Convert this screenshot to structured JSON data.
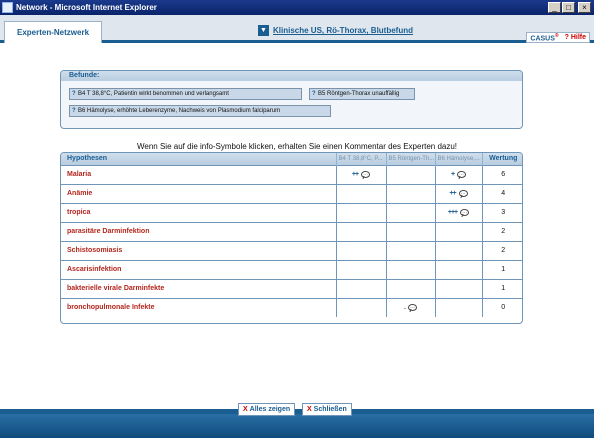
{
  "window": {
    "title": "Network - Microsoft Internet Explorer",
    "buttons": {
      "minimize": "_",
      "maximize": "□",
      "close": "×"
    }
  },
  "header": {
    "active_tab": "Experten-Netzwerk",
    "dropdown_label": "Klinische US, Rö-Thorax, Blutbefund",
    "casus_logo": "CASUS",
    "casus_mark": "®",
    "help_label": "? Hilfe"
  },
  "befunde": {
    "title": "Befunde:",
    "items": [
      "B4 T 38,8°C, Patientin wirkt benommen und verlangsamt",
      "B5 Röntgen-Thorax unauffällig",
      "B6 Hämolyse, erhöhte Leberenzyme, Nachweis von Plasmodium falciparum"
    ]
  },
  "instruction": "Wenn Sie auf die info-Symbole klicken, erhalten Sie einen Kommentar des Experten dazu!",
  "table": {
    "headers": {
      "hypothesis": "Hypothesen",
      "b4": "B4 T 38,8°C, P...",
      "b5": "B5 Röntgen-Th...",
      "b6": "B6 Hämolyse,...",
      "rating": "Wertung"
    },
    "rows": [
      {
        "name": "Malaria",
        "b4": "++",
        "b5": "",
        "b6": "+",
        "rating": "6"
      },
      {
        "name": "Anämie",
        "b4": "",
        "b5": "",
        "b6": "++",
        "rating": "4"
      },
      {
        "name": "tropica",
        "b4": "",
        "b5": "",
        "b6": "+++",
        "rating": "3"
      },
      {
        "name": "parasitäre Darminfektion",
        "b4": "",
        "b5": "",
        "b6": "",
        "rating": "2"
      },
      {
        "name": "Schistosomiasis",
        "b4": "",
        "b5": "",
        "b6": "",
        "rating": "2"
      },
      {
        "name": "Ascarisinfektion",
        "b4": "",
        "b5": "",
        "b6": "",
        "rating": "1"
      },
      {
        "name": "bakterielle virale Darminfekte",
        "b4": "",
        "b5": "",
        "b6": "",
        "rating": "1"
      },
      {
        "name": "bronchopulmonale Infekte",
        "b4": "",
        "b5": ".",
        "b6": "",
        "rating": "0"
      }
    ]
  },
  "footer": {
    "show_all": "Alles zeigen",
    "close": "Schließen",
    "x_mark": "X"
  },
  "colors": {
    "accent": "#1a5d91",
    "hypothesis_text": "#b3261e",
    "header_bg": "#dfe6ed"
  }
}
